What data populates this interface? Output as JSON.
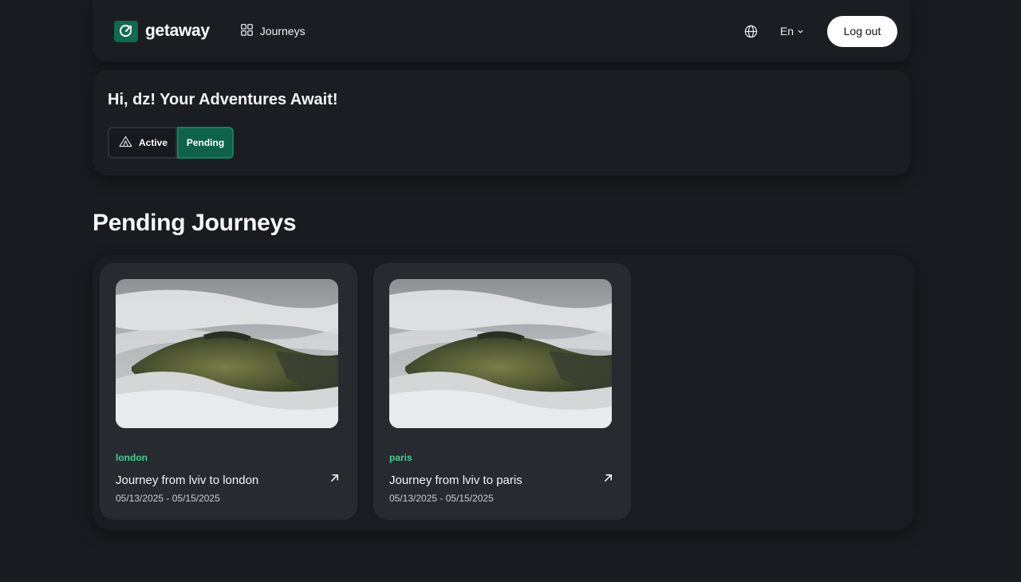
{
  "brand": {
    "name": "getaway",
    "accent": "#0f6b4d"
  },
  "nav": {
    "journeys_label": "Journeys",
    "language": "En",
    "logout_label": "Log out"
  },
  "greeting": {
    "title": "Hi, dz! Your Adventures Await!"
  },
  "tabs": [
    {
      "label": "Active",
      "icon": "tent-icon",
      "selected": false
    },
    {
      "label": "Pending",
      "selected": true
    }
  ],
  "section": {
    "title": "Pending Journeys"
  },
  "journeys": [
    {
      "destination": "london",
      "title": "Journey from lviv to london",
      "dates": "05/13/2025 - 05/15/2025",
      "image": "foggy-hill-photo"
    },
    {
      "destination": "paris",
      "title": "Journey from lviv to paris",
      "dates": "05/13/2025 - 05/15/2025",
      "image": "foggy-hill-photo"
    }
  ]
}
